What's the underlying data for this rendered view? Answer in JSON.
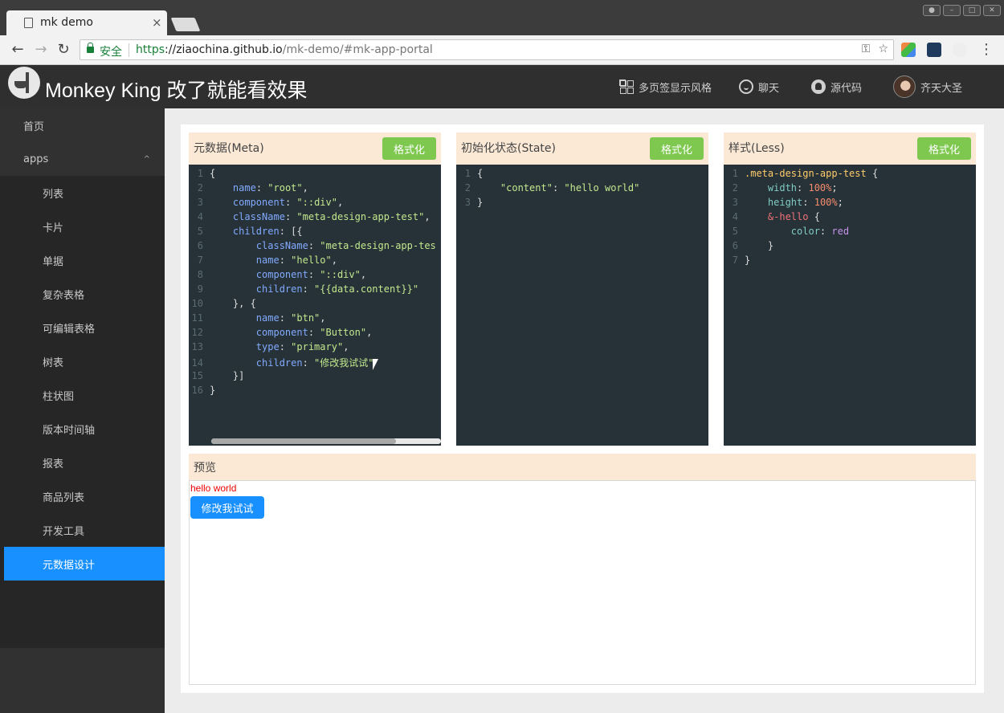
{
  "browser": {
    "tab_title": "mk demo",
    "tab_close": "×",
    "secure_label": "安全",
    "url_scheme": "https",
    "url_host": "://ziaochina.github.io",
    "url_path": "/mk-demo/#mk-app-portal"
  },
  "header": {
    "title": "Monkey King 改了就能看效果",
    "menu": [
      {
        "label": "多页签显示风格",
        "icon": "grid-icon"
      },
      {
        "label": "聊天",
        "icon": "smile-icon"
      },
      {
        "label": "源代码",
        "icon": "github-icon"
      },
      {
        "label": "齐天大圣",
        "icon": "avatar"
      }
    ]
  },
  "sidebar": {
    "home": "首页",
    "group": "apps",
    "group_caret": "^",
    "items": [
      "列表",
      "卡片",
      "单据",
      "复杂表格",
      "可编辑表格",
      "树表",
      "柱状图",
      "版本时间轴",
      "报表",
      "商品列表",
      "开发工具",
      "元数据设计"
    ],
    "active_index": 11
  },
  "panels": {
    "meta": {
      "title": "元数据(Meta)",
      "button": "格式化"
    },
    "state": {
      "title": "初始化状态(State)",
      "button": "格式化"
    },
    "style": {
      "title": "样式(Less)",
      "button": "格式化"
    }
  },
  "preview": {
    "title": "预览",
    "hello_text": "hello world",
    "button_label": "修改我试试"
  },
  "colors": {
    "accent": "#1890ff",
    "format_button": "#7ec850",
    "panel_header": "#fbe9d6",
    "editor_bg": "#263238",
    "sidebar_bg": "#313131"
  }
}
